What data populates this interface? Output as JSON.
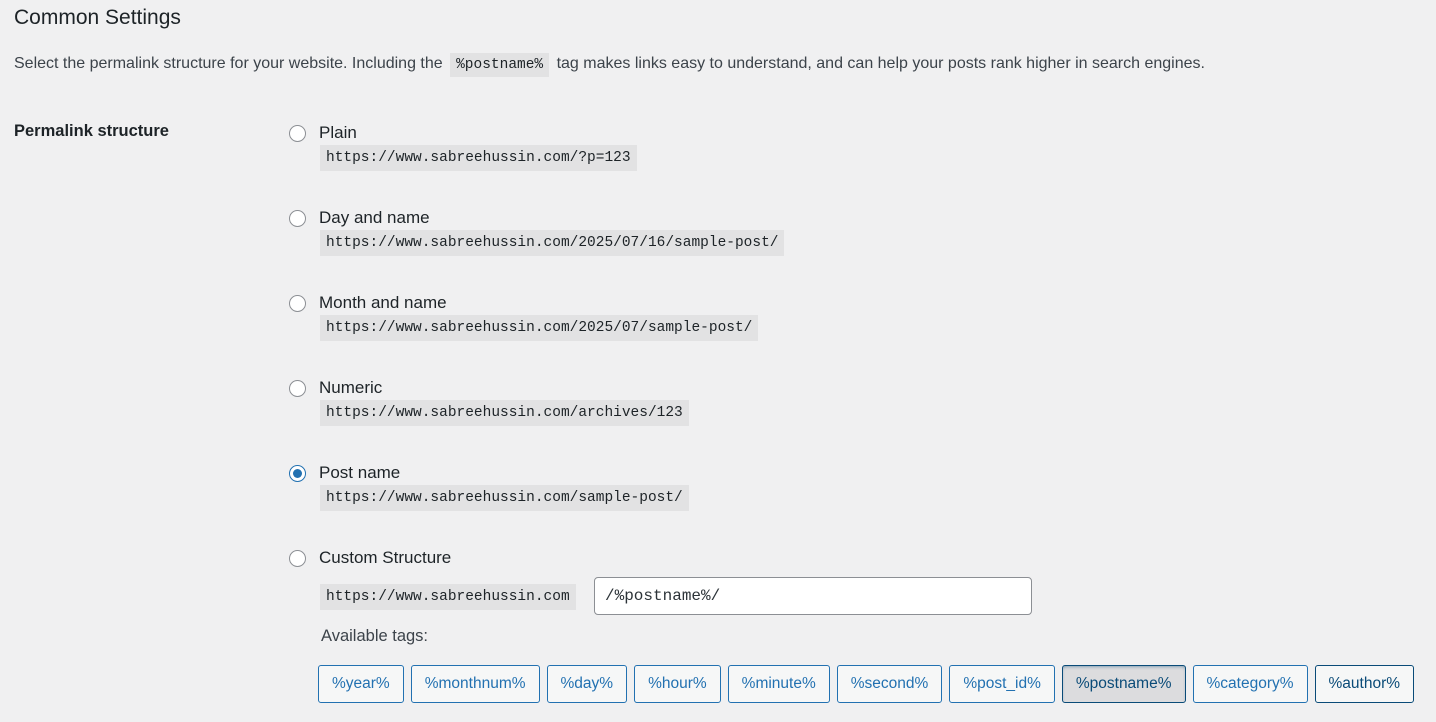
{
  "section": {
    "title": "Common Settings",
    "intro_before": "Select the permalink structure for your website. Including the",
    "intro_code": "%postname%",
    "intro_after": "tag makes links easy to understand, and can help your posts rank higher in search engines."
  },
  "permalink": {
    "label": "Permalink structure",
    "options": [
      {
        "label": "Plain",
        "url": "https://www.sabreehussin.com/?p=123",
        "checked": false
      },
      {
        "label": "Day and name",
        "url": "https://www.sabreehussin.com/2025/07/16/sample-post/",
        "checked": false
      },
      {
        "label": "Month and name",
        "url": "https://www.sabreehussin.com/2025/07/sample-post/",
        "checked": false
      },
      {
        "label": "Numeric",
        "url": "https://www.sabreehussin.com/archives/123",
        "checked": false
      },
      {
        "label": "Post name",
        "url": "https://www.sabreehussin.com/sample-post/",
        "checked": true
      }
    ],
    "custom": {
      "label": "Custom Structure",
      "prefix": "https://www.sabreehussin.com",
      "value": "/%postname%/",
      "checked": false
    },
    "available_tags_label": "Available tags:",
    "tags": [
      {
        "label": "%year%",
        "state": "normal"
      },
      {
        "label": "%monthnum%",
        "state": "normal"
      },
      {
        "label": "%day%",
        "state": "normal"
      },
      {
        "label": "%hour%",
        "state": "normal"
      },
      {
        "label": "%minute%",
        "state": "normal"
      },
      {
        "label": "%second%",
        "state": "normal"
      },
      {
        "label": "%post_id%",
        "state": "normal"
      },
      {
        "label": "%postname%",
        "state": "active"
      },
      {
        "label": "%category%",
        "state": "normal"
      },
      {
        "label": "%author%",
        "state": "dark"
      }
    ]
  },
  "colors": {
    "accent": "#2271b1",
    "background": "#f0f0f1",
    "code_background": "#e2e2e3"
  }
}
